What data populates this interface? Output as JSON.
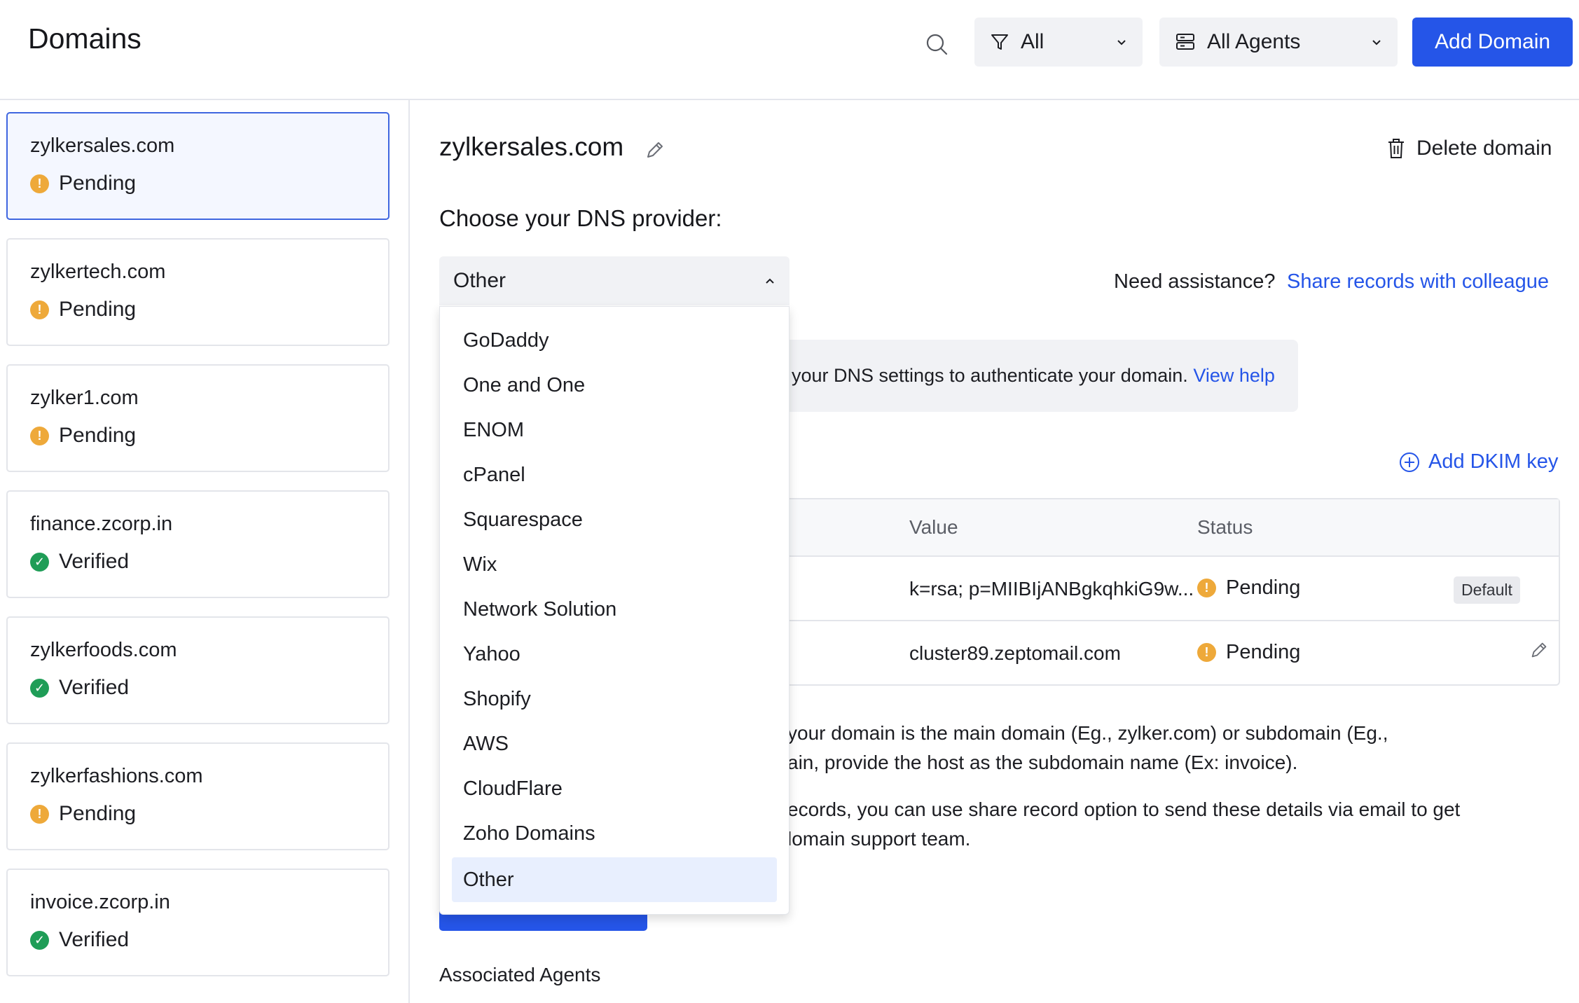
{
  "header": {
    "title": "Domains",
    "filter_label": "All",
    "agents_label": "All Agents",
    "add_domain_label": "Add Domain"
  },
  "sidebar": {
    "domains": [
      {
        "name": "zylkersales.com",
        "status": "Pending"
      },
      {
        "name": "zylkertech.com",
        "status": "Pending"
      },
      {
        "name": "zylker1.com",
        "status": "Pending"
      },
      {
        "name": "finance.zcorp.in",
        "status": "Verified"
      },
      {
        "name": "zylkerfoods.com",
        "status": "Verified"
      },
      {
        "name": "zylkerfashions.com",
        "status": "Pending"
      },
      {
        "name": "invoice.zcorp.in",
        "status": "Verified"
      }
    ]
  },
  "main": {
    "domain_name": "zylkersales.com",
    "delete_label": "Delete domain",
    "dns_heading": "Choose your DNS provider:",
    "dns_selected": "Other",
    "assist_text": "Need assistance?",
    "share_link": "Share records with colleague",
    "info_text": "your DNS settings to authenticate your domain.",
    "info_link": "View help",
    "add_dkim_label": "Add DKIM key",
    "table": {
      "headers": [
        "Value",
        "Status"
      ],
      "rows": [
        {
          "value": "k=rsa; p=MIIBIjANBgkqhkiG9w...",
          "status": "Pending",
          "badge": "Default"
        },
        {
          "value": "cluster89.zeptomail.com",
          "status": "Pending"
        }
      ]
    },
    "para1_line1": "your domain is the main domain (Eg., zylker.com) or subdomain (Eg.,",
    "para1_line2": "ain, provide the host as the subdomain name (Ex: invoice).",
    "para2_line1": "ecords, you can use share record option to send these details via email to get",
    "para2_line2": "lomain support team.",
    "associated_agents": "Associated Agents"
  },
  "dropdown": {
    "options": [
      "GoDaddy",
      "One and One",
      "ENOM",
      "cPanel",
      "Squarespace",
      "Wix",
      "Network Solution",
      "Yahoo",
      "Shopify",
      "AWS",
      "CloudFlare",
      "Zoho Domains",
      "Other"
    ],
    "active_index": 12
  },
  "colors": {
    "accent": "#2555e8",
    "pending": "#eea93a",
    "verified": "#1f9d57",
    "selected_bg": "#f4f7ff"
  }
}
